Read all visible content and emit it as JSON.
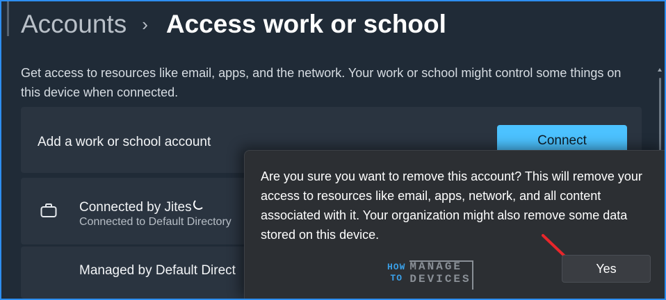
{
  "breadcrumb": {
    "parent": "Accounts",
    "separator": "›",
    "current": "Access work or school"
  },
  "description": "Get access to resources like email, apps, and the network. Your work or school might control some things on this device when connected.",
  "add_account": {
    "label": "Add a work or school account",
    "button_label": "Connect"
  },
  "account": {
    "icon": "briefcase-icon",
    "title": "Connected by Jites",
    "subtitle": "Connected to Default Directory"
  },
  "managed": {
    "label": "Managed by Default Direct"
  },
  "dialog": {
    "message": "Are you sure you want to remove this account? This will remove your access to resources like email, apps, network, and all content associated with it. Your organization might also remove some data stored on this device.",
    "yes_label": "Yes"
  },
  "watermark": {
    "how": "HOW",
    "to": "TO",
    "manage": "MANAGE",
    "devices": "DEVICES"
  },
  "colors": {
    "accent": "#4cc2ff",
    "frame": "#2d8ef0",
    "arrow": "#e8262b"
  }
}
